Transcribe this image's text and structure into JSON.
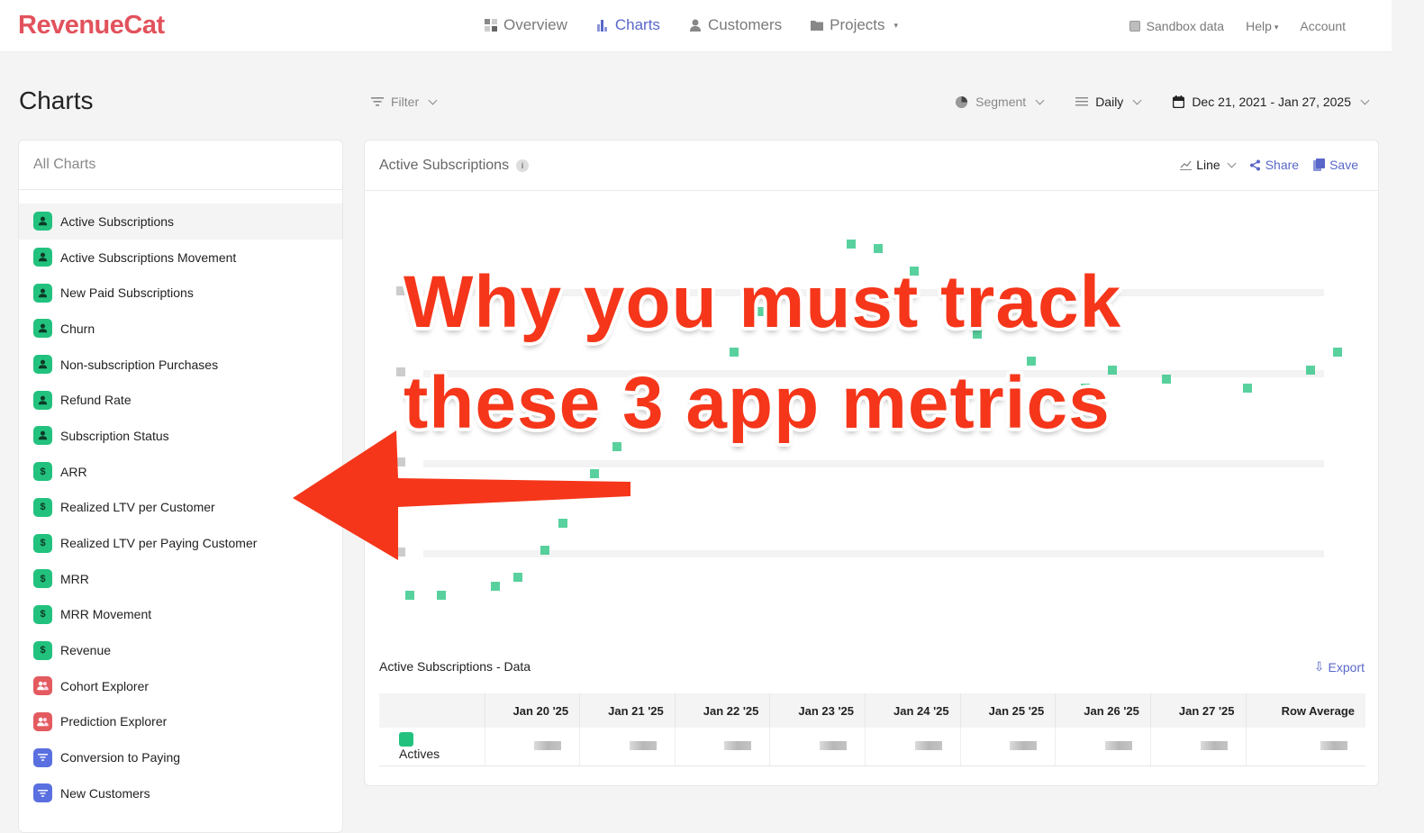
{
  "app": {
    "brand": "RevenueCat",
    "brand_color": "#e2525c",
    "accent_color": "#5967c9"
  },
  "nav": {
    "items": [
      {
        "label": "Overview",
        "icon": "grid-icon",
        "active": false
      },
      {
        "label": "Charts",
        "icon": "bar-chart-icon",
        "active": true
      },
      {
        "label": "Customers",
        "icon": "user-icon",
        "active": false
      },
      {
        "label": "Projects",
        "icon": "folder-icon",
        "active": false,
        "dropdown": true
      }
    ],
    "sandbox_label": "Sandbox data",
    "help_label": "Help",
    "account_label": "Account"
  },
  "page": {
    "title": "Charts"
  },
  "toolbar": {
    "filter_label": "Filter",
    "segment_label": "Segment",
    "resolution_label": "Daily",
    "date_range": "Dec 21, 2021 - Jan 27, 2025"
  },
  "sidebar": {
    "header": "All Charts",
    "items": [
      {
        "label": "Active Subscriptions",
        "icon": "user-icon",
        "color": "green",
        "active": true
      },
      {
        "label": "Active Subscriptions Movement",
        "icon": "user-icon",
        "color": "green"
      },
      {
        "label": "New Paid Subscriptions",
        "icon": "user-icon",
        "color": "green"
      },
      {
        "label": "Churn",
        "icon": "user-icon",
        "color": "green"
      },
      {
        "label": "Non-subscription Purchases",
        "icon": "user-icon",
        "color": "green"
      },
      {
        "label": "Refund Rate",
        "icon": "user-icon",
        "color": "green"
      },
      {
        "label": "Subscription Status",
        "icon": "user-icon",
        "color": "green"
      },
      {
        "label": "ARR",
        "icon": "dollar-icon",
        "color": "green"
      },
      {
        "label": "Realized LTV per Customer",
        "icon": "dollar-icon",
        "color": "green"
      },
      {
        "label": "Realized LTV per Paying Customer",
        "icon": "dollar-icon",
        "color": "green"
      },
      {
        "label": "MRR",
        "icon": "dollar-icon",
        "color": "green"
      },
      {
        "label": "MRR Movement",
        "icon": "dollar-icon",
        "color": "green"
      },
      {
        "label": "Revenue",
        "icon": "dollar-icon",
        "color": "green"
      },
      {
        "label": "Cohort Explorer",
        "icon": "users-icon",
        "color": "red"
      },
      {
        "label": "Prediction Explorer",
        "icon": "users-icon",
        "color": "red"
      },
      {
        "label": "Conversion to Paying",
        "icon": "funnel-icon",
        "color": "blue"
      },
      {
        "label": "New Customers",
        "icon": "funnel-icon",
        "color": "blue"
      }
    ]
  },
  "chart_panel": {
    "title": "Active Subscriptions",
    "chart_type_label": "Line",
    "share_label": "Share",
    "save_label": "Save"
  },
  "overlay": {
    "line1": "Why you must track",
    "line2": "these 3 app metrics",
    "color": "#f5361a"
  },
  "data_table": {
    "title": "Active Subscriptions - Data",
    "export_label": "Export",
    "columns": [
      "Jan 20 '25",
      "Jan 21 '25",
      "Jan 22 '25",
      "Jan 23 '25",
      "Jan 24 '25",
      "Jan 25 '25",
      "Jan 26 '25",
      "Jan 27 '25",
      "Row Average"
    ],
    "rows": [
      {
        "label": "Actives",
        "color": "#22c27e"
      }
    ]
  }
}
